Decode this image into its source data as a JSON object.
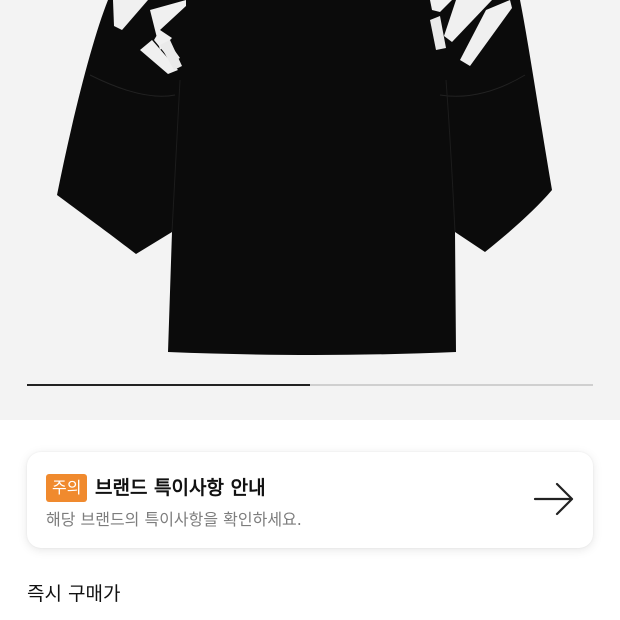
{
  "product_image": {
    "alt": "black oversized t-shirt",
    "carousel_progress": 0.5
  },
  "notice": {
    "badge": "주의",
    "title": "브랜드 특이사항 안내",
    "description": "해당 브랜드의 특이사항을 확인하세요.",
    "action_icon": "arrow-right-icon",
    "badge_color": "#f08a2e"
  },
  "section": {
    "title": "즉시 구매가"
  }
}
